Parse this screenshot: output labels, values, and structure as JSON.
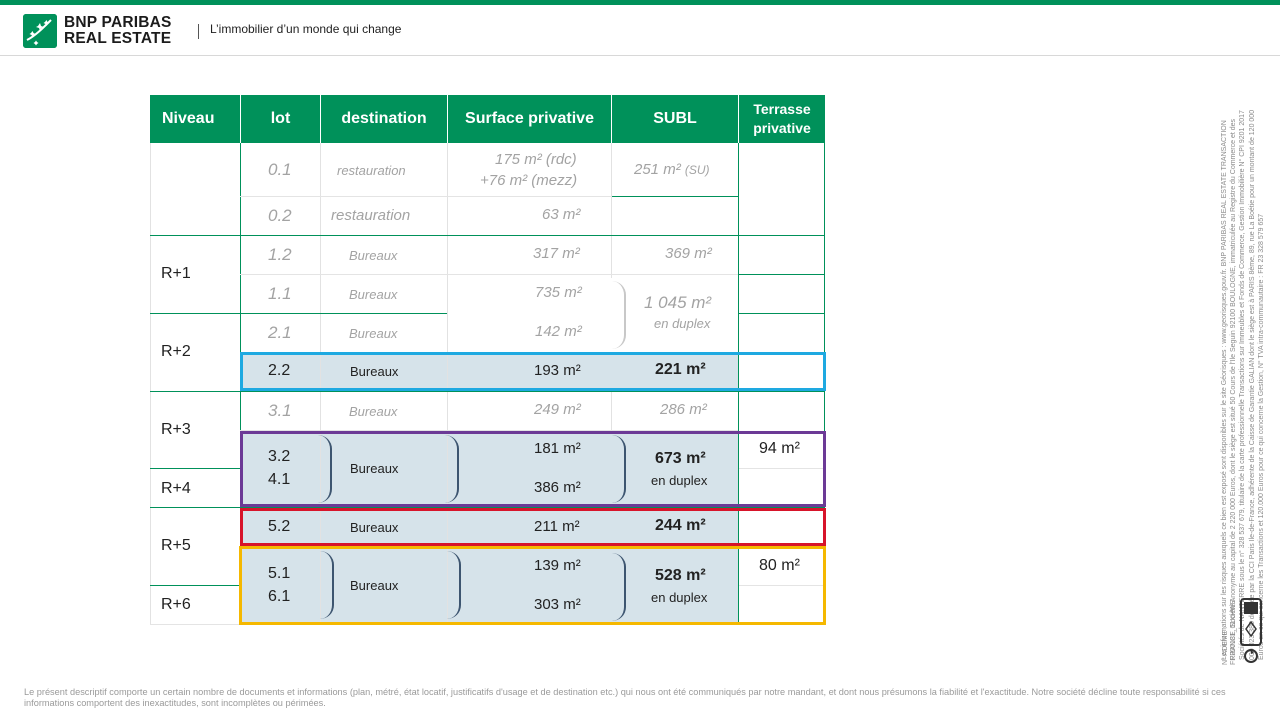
{
  "header": {
    "brand_line1": "BNP PARIBAS",
    "brand_line2": "REAL ESTATE",
    "tagline": "L’immobilier d’un monde qui change",
    "accent_color": "#00915a"
  },
  "table": {
    "headers": [
      "Niveau",
      "lot",
      "destination",
      "Surface privative",
      "SUBL",
      "Terrasse\nprivative"
    ],
    "levels": [
      "R+1",
      "R+2",
      "R+3",
      "R+4",
      "R+5",
      "R+6"
    ],
    "rows": [
      {
        "lot": "0.1",
        "destination": "restauration",
        "surface_line1": "175 m² (rdc)",
        "surface_line2": "+76 m² (mezz)",
        "subl": "251 m²",
        "subl_suffix": "(SU)"
      },
      {
        "lot": "0.2",
        "destination": "restauration",
        "surface": "63 m²"
      },
      {
        "lot": "1.2",
        "destination": "Bureaux",
        "surface": "317 m²",
        "subl": "369 m²"
      },
      {
        "lot": "1.1",
        "destination": "Bureaux",
        "surface": "735 m²"
      },
      {
        "lot": "2.1",
        "destination": "Bureaux",
        "surface": "142 m²",
        "subl_group": "1 045 m²",
        "subl_group_note": "en duplex"
      },
      {
        "lot": "2.2",
        "destination": "Bureaux",
        "surface": "193 m²",
        "subl": "221 m²"
      },
      {
        "lot": "3.1",
        "destination": "Bureaux",
        "surface": "249 m²",
        "subl": "286 m²"
      },
      {
        "lot": "3.2",
        "lot_b": "4.1",
        "destination": "Bureaux",
        "surface_a": "181 m²",
        "surface_b": "386 m²",
        "subl": "673 m²",
        "subl_note": "en duplex",
        "terrasse": "94 m²"
      },
      {
        "lot": "5.2",
        "destination": "Bureaux",
        "surface": "211 m²",
        "subl": "244 m²"
      },
      {
        "lot": "5.1",
        "lot_b": "6.1",
        "destination": "Bureaux",
        "surface_a": "139 m²",
        "surface_b": "303 m²",
        "subl": "528 m²",
        "subl_note": "en duplex",
        "terrasse": "80 m²"
      }
    ],
    "highlight_colors": {
      "lot_2_2": "#1ea9e1",
      "lots_3_2_4_1": "#6c3a96",
      "lot_5_2": "#d7142a",
      "lots_5_1_6_1": "#f5b800"
    }
  },
  "side_note": "Les informations sur les risques auxquels ce bien est exposé sont disponibles sur le site Géorisques : www.georisques.gouv.fr. BNP PARIBAS REAL ESTATE TRANSACTION FRANCE, Société Anonyme au capital de 2 220 000 Euros, dont le siège est situé 50 Cours de l'Ile Seguin 92100 BOULOGNE, immatriculée au Registre du Commerce et des Sociétés de NANTERRE sous le n° 328 537 679, titulaire de la carte professionnelle Transactions sur Immeubles et Fonds de Commerce, Gestion Immobilière N° CPI 9201 2017 000 023 386 délivrée par la CCI Paris Ile-de-France, adhérente de la Caisse de Garantie GALIAN dont le siège est à PARIS 8ème, 89, rue La Boétie pour un montant de 120 000 Euros en ce qui concerne les Transactions et 120.000 Euros pour ce qui concerne la Gestion, N° TVA intra-communautaire : FR 23 328 579 657",
  "ademe": "N° ADEME : FR200181_01XHWE",
  "footer": "Le présent descriptif comporte un certain nombre de documents et informations (plan, métré, état locatif, justificatifs d'usage et de destination etc.) qui nous ont été communiqués par notre mandant, et dont nous présumons la fiabilité et l'exactitude. Notre société décline toute responsabilité si ces informations comportent des inexactitudes, sont incomplètes ou périmées."
}
